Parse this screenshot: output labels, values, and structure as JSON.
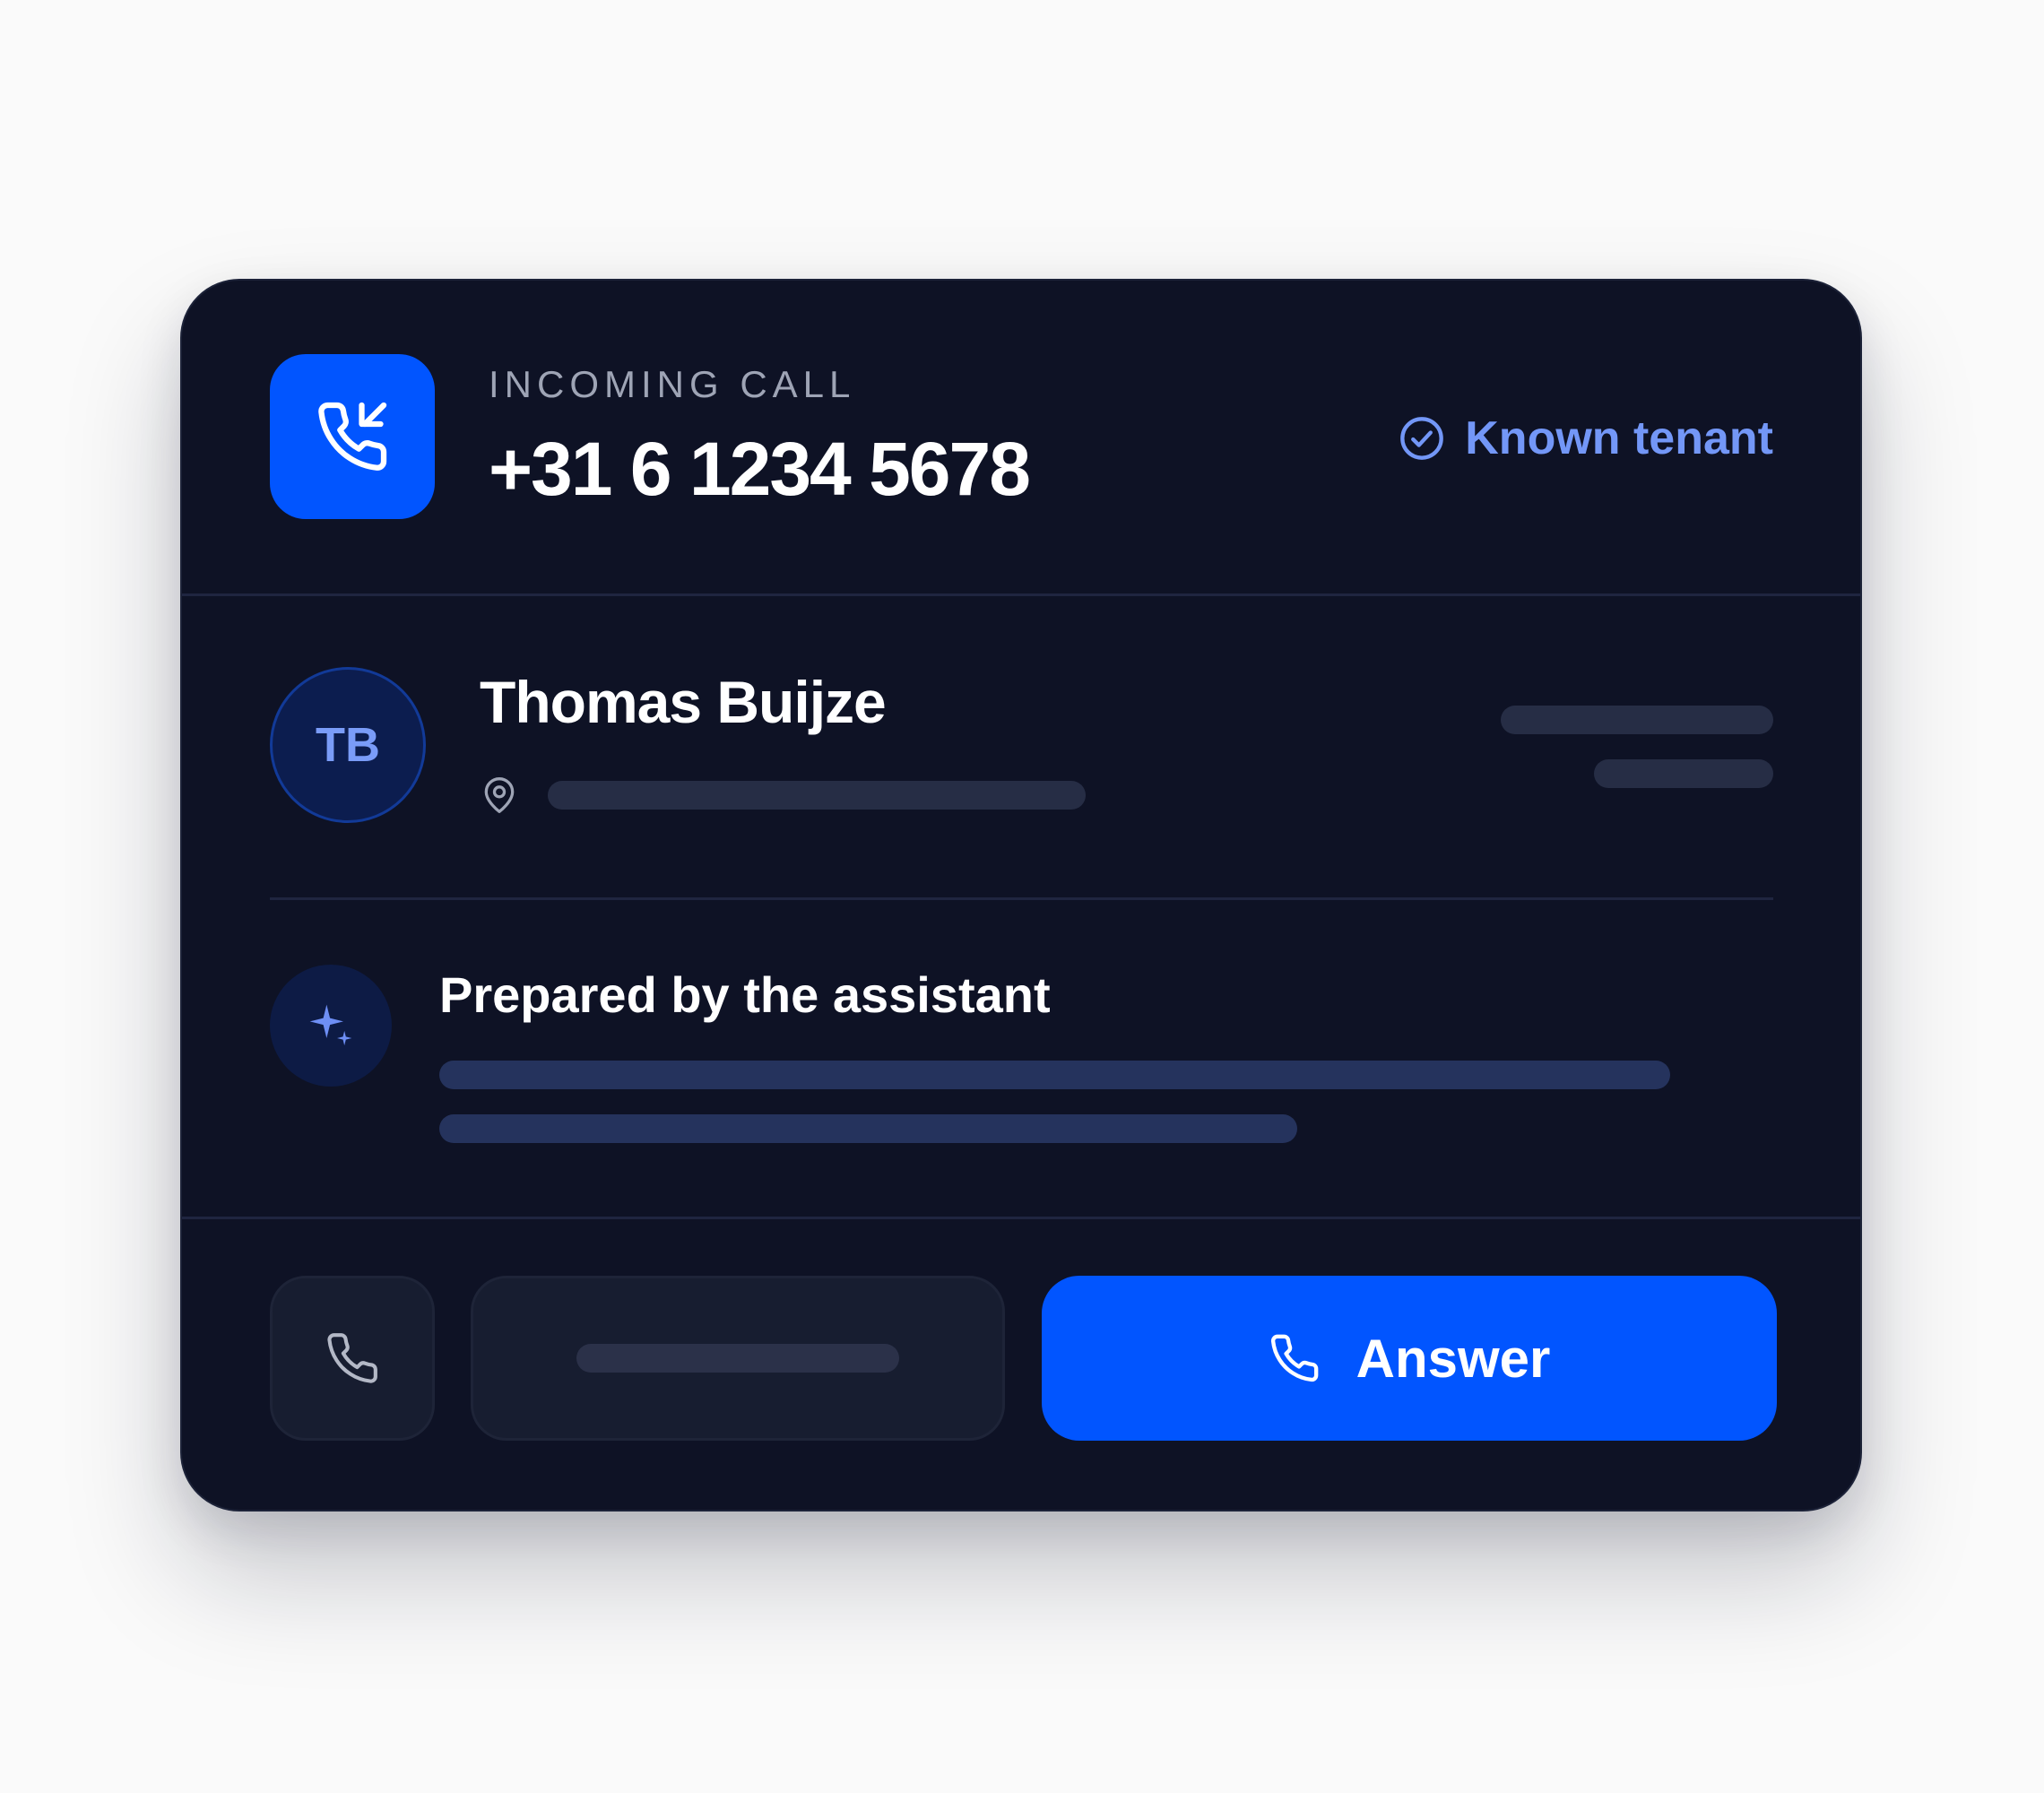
{
  "header": {
    "label": "INCOMING CALL",
    "phone_number": "+31 6 1234 5678",
    "status": "Known tenant"
  },
  "contact": {
    "initials": "TB",
    "name": "Thomas Buijze"
  },
  "assistant": {
    "title": "Prepared by the assistant"
  },
  "actions": {
    "answer_label": "Answer"
  },
  "colors": {
    "card_background": "#0e1225",
    "accent_blue": "#0155ff",
    "known_tenant": "#7397f7"
  },
  "icons": [
    "incoming-call-icon",
    "check-circle-icon",
    "map-pin-icon",
    "sparkles-icon",
    "phone-icon"
  ]
}
